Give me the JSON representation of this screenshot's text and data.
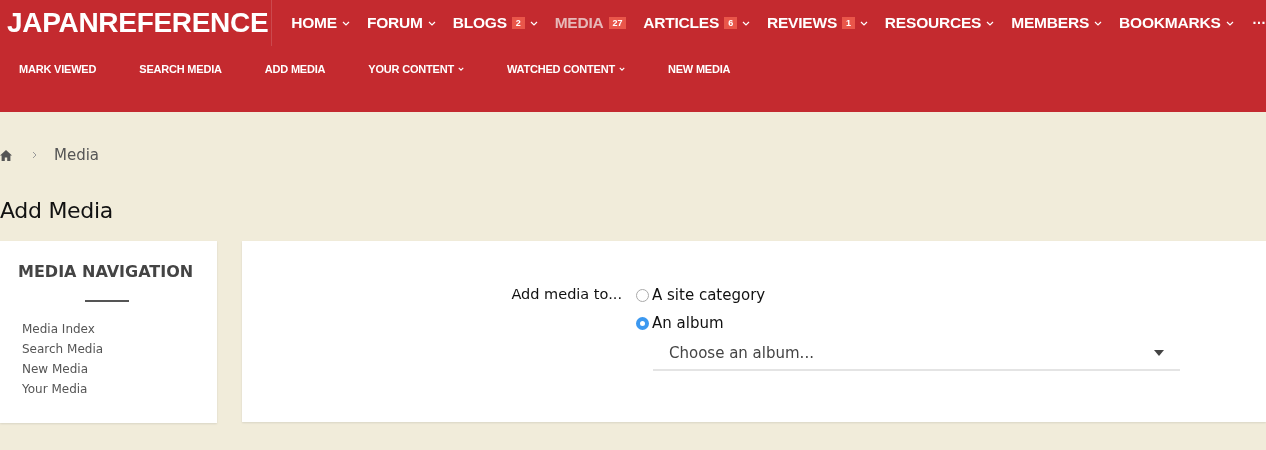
{
  "header": {
    "logo": "JAPANREFERENCE",
    "nav": [
      {
        "label": "HOME",
        "caret": true,
        "selected": false
      },
      {
        "label": "FORUM",
        "caret": true,
        "selected": false
      },
      {
        "label": "BLOGS",
        "badge": "2",
        "caret": true,
        "selected": false
      },
      {
        "label": "MEDIA",
        "badge": "27",
        "caret": false,
        "selected": true
      },
      {
        "label": "ARTICLES",
        "badge": "6",
        "caret": true,
        "selected": false
      },
      {
        "label": "REVIEWS",
        "badge": "1",
        "caret": true,
        "selected": false
      },
      {
        "label": "RESOURCES",
        "caret": true,
        "selected": false
      },
      {
        "label": "MEMBERS",
        "caret": true,
        "selected": false
      },
      {
        "label": "BOOKMARKS",
        "caret": true,
        "selected": false
      }
    ],
    "more": "···",
    "subnav": [
      {
        "label": "MARK VIEWED",
        "caret": false
      },
      {
        "label": "SEARCH MEDIA",
        "caret": false
      },
      {
        "label": "ADD MEDIA",
        "caret": false
      },
      {
        "label": "YOUR CONTENT",
        "caret": true
      },
      {
        "label": "WATCHED CONTENT",
        "caret": true
      },
      {
        "label": "NEW MEDIA",
        "caret": false
      }
    ]
  },
  "breadcrumb": {
    "items": [
      "Media"
    ]
  },
  "page_title": "Add Media",
  "sidebar": {
    "title": "MEDIA NAVIGATION",
    "items": [
      "Media Index",
      "Search Media",
      "New Media",
      "Your Media"
    ]
  },
  "form": {
    "label": "Add media to...",
    "options": [
      {
        "label": "A site category",
        "selected": false
      },
      {
        "label": "An album",
        "selected": true
      }
    ],
    "album_select": {
      "value": "Choose an album..."
    }
  }
}
